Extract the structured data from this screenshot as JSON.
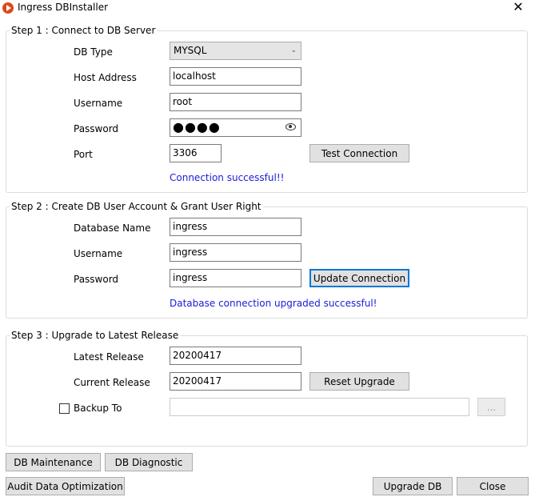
{
  "window": {
    "title": "Ingress DBInstaller",
    "close_glyph": "✕"
  },
  "step1": {
    "legend": "Step 1 : Connect to DB Server",
    "db_type_label": "DB Type",
    "db_type_value": "MYSQL",
    "host_label": "Host Address",
    "host_value": "localhost",
    "username_label": "Username",
    "username_value": "root",
    "password_label": "Password",
    "password_mask": "●●●●",
    "port_label": "Port",
    "port_value": "3306",
    "test_button": "Test Connection",
    "status": "Connection successful!!"
  },
  "step2": {
    "legend": "Step 2 : Create DB User Account & Grant User Right",
    "dbname_label": "Database Name",
    "dbname_value": "ingress",
    "username_label": "Username",
    "username_value": "ingress",
    "password_label": "Password",
    "password_value": "ingress",
    "update_button": "Update Connection",
    "status": "Database connection upgraded successful!"
  },
  "step3": {
    "legend": "Step 3 : Upgrade to Latest Release",
    "latest_label": "Latest Release",
    "latest_value": "20200417",
    "current_label": "Current Release",
    "current_value": "20200417",
    "reset_button": "Reset Upgrade",
    "backup_label": "Backup To",
    "backup_value": "",
    "browse_button": "..."
  },
  "footer": {
    "maintenance": "DB Maintenance",
    "diagnostic": "DB Diagnostic",
    "audit": "Audit Data Optimization",
    "upgrade": "Upgrade DB",
    "close": "Close"
  },
  "colors": {
    "status_text": "#1b1bd8",
    "focus_border": "#0078d7"
  },
  "icons": [
    "app-icon",
    "close-icon",
    "chevron-down-icon",
    "eye-icon"
  ]
}
